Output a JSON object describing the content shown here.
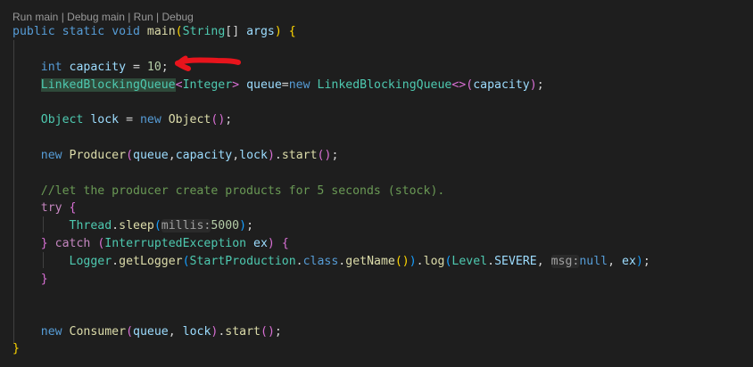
{
  "codelens": {
    "run_main": "Run main",
    "sep1": " | ",
    "debug_main": "Debug main",
    "sep2": " | ",
    "run": "Run",
    "sep3": " | ",
    "debug": "Debug"
  },
  "code": {
    "l1": {
      "a": "public",
      "b": "static",
      "c": "void",
      "d": "main",
      "e": "String",
      "f": "args"
    },
    "l3": {
      "a": "int",
      "b": "capacity",
      "c": "10"
    },
    "l4": {
      "a": "LinkedBlockingQueue",
      "b": "Integer",
      "c": "queue",
      "d": "new",
      "e": "LinkedBlockingQueue",
      "f": "capacity"
    },
    "l6": {
      "a": "Object",
      "b": "lock",
      "c": "new",
      "d": "Object"
    },
    "l8": {
      "a": "new",
      "b": "Producer",
      "c": "queue",
      "d": "capacity",
      "e": "lock",
      "f": "start"
    },
    "l10": {
      "comment": "//let the producer create products for 5 seconds (stock)."
    },
    "l11": {
      "a": "try"
    },
    "l12": {
      "a": "Thread",
      "b": "sleep",
      "hint": "millis:",
      "c": "5000"
    },
    "l13": {
      "a": "catch",
      "b": "InterruptedException",
      "c": "ex"
    },
    "l14": {
      "a": "Logger",
      "b": "getLogger",
      "c": "StartProduction",
      "d": "class",
      "e": "getName",
      "f": "log",
      "g": "Level",
      "h": "SEVERE",
      "hint": "msg:",
      "i": "null",
      "j": "ex"
    },
    "l18": {
      "a": "new",
      "b": "Consumer",
      "c": "queue",
      "d": "lock",
      "e": "start"
    }
  },
  "colors": {
    "background": "#1e1e1e",
    "keyword": "#569cd6",
    "control": "#c586c0",
    "type": "#4ec9b0",
    "variable": "#9cdcfe",
    "function": "#dcdcaa",
    "number": "#b5cea8",
    "comment": "#6a9955",
    "annotation_arrow": "#e8141c"
  }
}
